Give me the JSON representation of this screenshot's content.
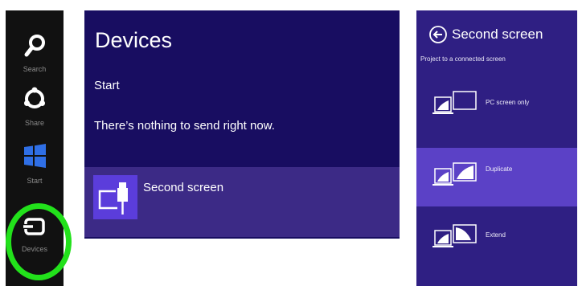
{
  "charms": {
    "search_label": "Search",
    "share_label": "Share",
    "start_label": "Start",
    "devices_label": "Devices",
    "highlight_color": "#22e11b"
  },
  "devices_pane": {
    "title": "Devices",
    "subhead": "Start",
    "message": "There’s nothing to send right now.",
    "item_label": "Second screen",
    "background": "#180d61",
    "accent": "#5b3ddb"
  },
  "second_screen_pane": {
    "title": "Second screen",
    "subtitle": "Project to a connected screen",
    "options": [
      {
        "label": "PC screen only",
        "selected": false
      },
      {
        "label": "Duplicate",
        "selected": true
      },
      {
        "label": "Extend",
        "selected": false
      }
    ],
    "background": "#2f1f83",
    "selected_background": "#5b41c6"
  },
  "icons": {
    "search": "magnifier-icon",
    "share": "share-icon",
    "start": "windows-logo-icon",
    "devices": "devices-icon",
    "second_screen": "project-screen-icon",
    "back": "back-arrow-icon"
  }
}
